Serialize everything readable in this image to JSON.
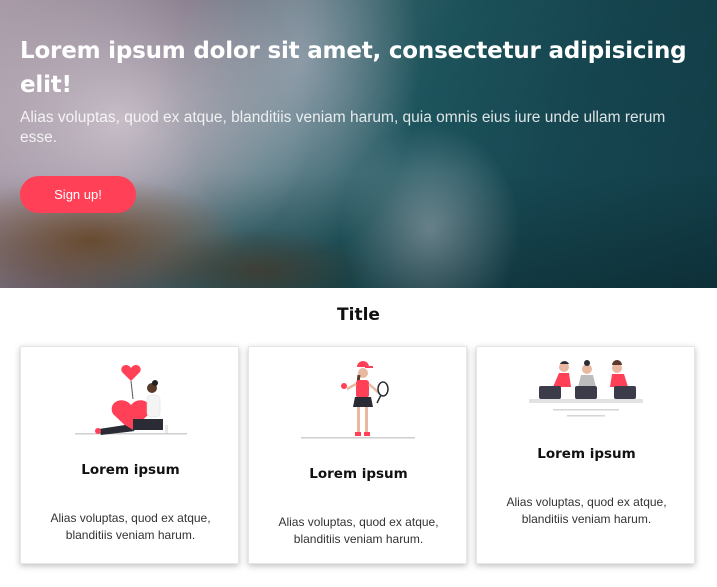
{
  "hero": {
    "title": "Lorem ipsum dolor sit amet, consectetur adipisicing elit!",
    "subtitle": "Alias voluptas, quod ex atque, blanditiis veniam harum, quia omnis eius iure unde ullam rerum esse.",
    "cta_label": "Sign up!",
    "background_image": "ocean-coast-photo"
  },
  "section": {
    "title": "Title"
  },
  "cards": [
    {
      "title": "Lorem ipsum",
      "text": "Alias voluptas, quod ex atque, blanditiis veniam harum.",
      "illustration": "woman-with-heart-illustration"
    },
    {
      "title": "Lorem ipsum",
      "text": "Alias voluptas, quod ex atque, blanditiis veniam harum.",
      "illustration": "tennis-player-illustration"
    },
    {
      "title": "Lorem ipsum",
      "text": "Alias voluptas, quod ex atque, blanditiis veniam harum.",
      "illustration": "team-meeting-illustration"
    }
  ],
  "colors": {
    "accent": "#ff4057",
    "text": "#111111"
  }
}
